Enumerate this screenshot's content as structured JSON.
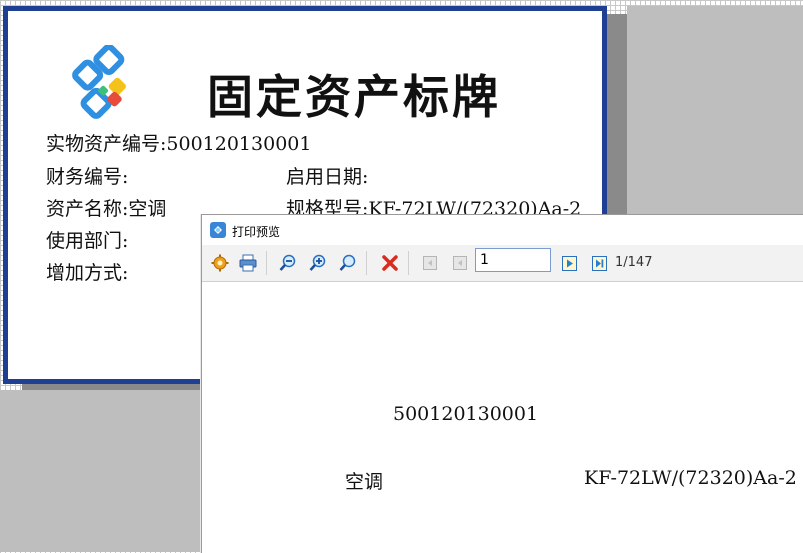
{
  "label": {
    "title": "固定资产标牌",
    "asset_no_label": "实物资产编号:",
    "asset_no_value": "500120130001",
    "finance_no_label": "财务编号:",
    "start_date_label": "启用日期:",
    "asset_name_label": "资产名称:",
    "asset_name_value": "空调",
    "spec_label": "规格型号:",
    "spec_value": "KF-72LW/(72320)Aa-2",
    "dept_label": "使用部门:",
    "add_method_label": "增加方式:"
  },
  "preview_window": {
    "title": "打印预览",
    "page_input_value": "1",
    "page_count": "1/147",
    "page": {
      "asset_no": "500120130001",
      "asset_name": "空调",
      "spec": "KF-72LW/(72320)Aa-2"
    }
  },
  "colors": {
    "label_border": "#1f3f93",
    "gray_area": "#bebebe",
    "delete_red": "#d92b1e",
    "nav_blue": "#2a7fd4"
  },
  "icons": {
    "settings": "gear-icon",
    "print": "printer-icon",
    "zoom_out": "zoom-out-icon",
    "zoom_in": "zoom-in-icon",
    "zoom_fit": "zoom-fit-icon",
    "close": "close-red-x-icon",
    "first": "first-page-icon",
    "prev": "prev-page-icon",
    "next": "next-page-icon",
    "last": "last-page-icon"
  }
}
